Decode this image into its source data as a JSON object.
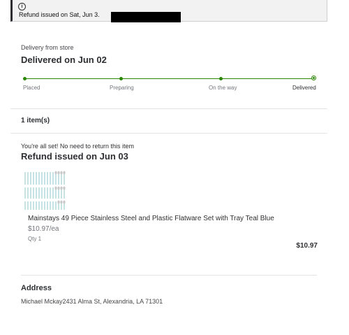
{
  "banner": {
    "icon": "info-icon",
    "message": "Refund issued on Sat, Jun 3."
  },
  "delivery": {
    "source": "Delivery from store",
    "status_title": "Delivered on Jun 02",
    "steps": [
      "Placed",
      "Preparing",
      "On the way",
      "Delivered"
    ],
    "accent": "#2a8703"
  },
  "items": {
    "count_label": "1 item(s)",
    "return_note": "You're all set! No need to return this item",
    "refund_title": "Refund issued on Jun 03",
    "product": {
      "name": "Mainstays 49 Piece Stainless Steel and Plastic Flatware Set with Tray Teal Blue",
      "unit_price": "$10.97/ea",
      "qty": "Qty 1",
      "total": "$10.97"
    }
  },
  "address": {
    "title": "Address",
    "line": "Michael Mckay2431 Alma St, Alexandria, LA 71301"
  }
}
